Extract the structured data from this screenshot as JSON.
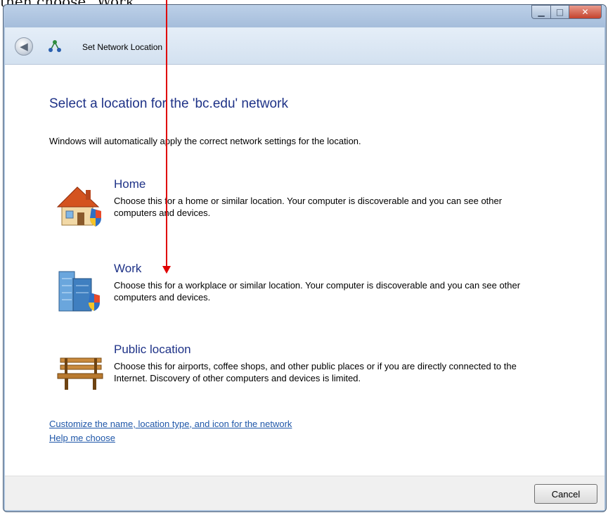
{
  "caption": {
    "text": "then choose \"Work\""
  },
  "window": {
    "title": "Set Network Location",
    "min_glyph": "▁",
    "max_glyph": "□",
    "close_glyph": "✕"
  },
  "nav": {
    "back_glyph": "◀"
  },
  "main": {
    "heading": "Select a location for the 'bc.edu' network",
    "instruction": "Windows will automatically apply the correct network settings for the location.",
    "options": [
      {
        "title": "Home",
        "description": "Choose this for a home or similar location. Your computer is discoverable and you can see other computers and devices.",
        "icon": "house-icon"
      },
      {
        "title": "Work",
        "description": "Choose this for a workplace or similar location. Your computer is discoverable and you can see other computers and devices.",
        "icon": "office-building-icon"
      },
      {
        "title": "Public location",
        "description": "Choose this for airports, coffee shops, and other public places or if you are directly connected to the Internet. Discovery of other computers and devices is limited.",
        "icon": "park-bench-icon"
      }
    ],
    "links": {
      "customize": "Customize the name, location type, and icon for the network",
      "help": "Help me choose"
    }
  },
  "footer": {
    "cancel_label": "Cancel"
  },
  "colors": {
    "heading": "#1e3287",
    "link": "#1e56a8",
    "annotation_arrow": "#e00000"
  }
}
